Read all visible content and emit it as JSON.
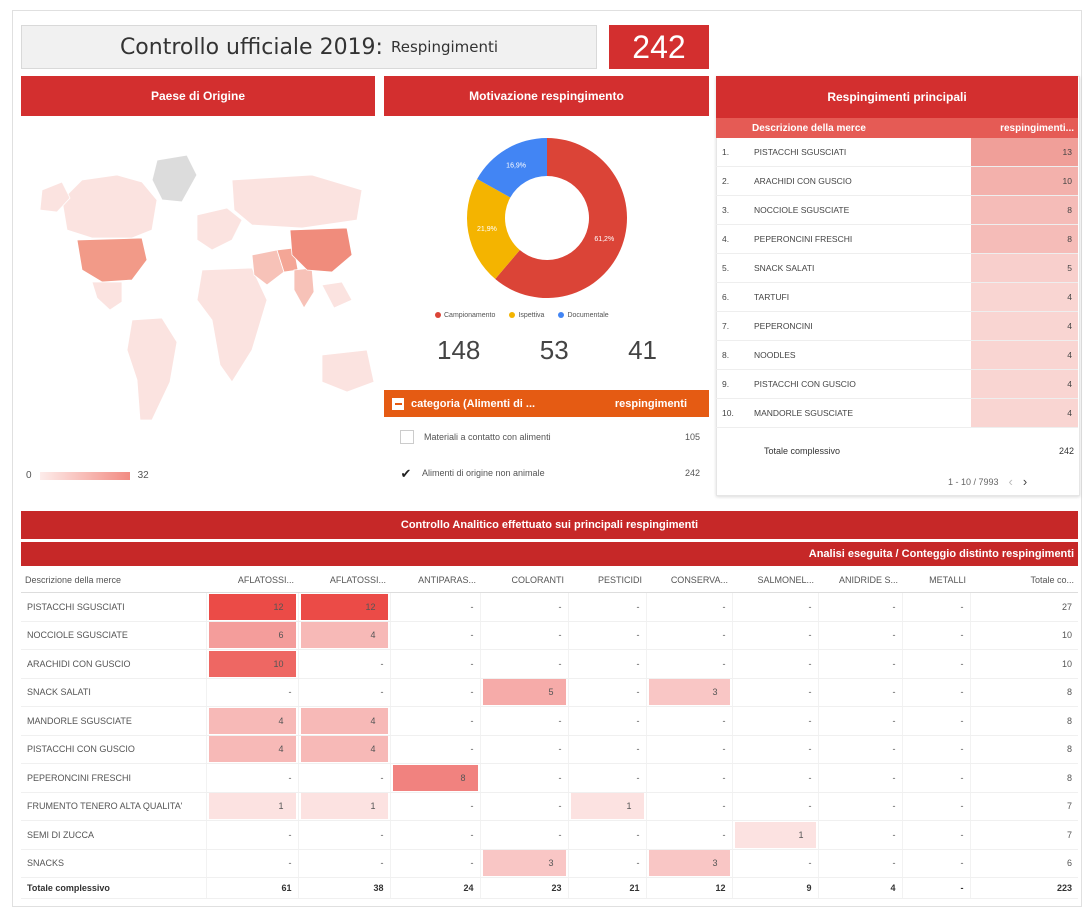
{
  "title": {
    "main": "Controllo ufficiale 2019:",
    "sub": "Respingimenti"
  },
  "total_count": "242",
  "panels": {
    "country": "Paese di Origine",
    "reason": "Motivazione respingimento",
    "top": "Respingimenti principali",
    "bottom": "Controllo Analitico effettuato sui principali respingimenti",
    "bottom_sub": "Analisi eseguita / Conteggio distinto respingimenti"
  },
  "map_legend": {
    "min": "0",
    "max": "32"
  },
  "donut": {
    "slices": [
      {
        "label": "Campionamento",
        "percent": 61.2,
        "text": "61,2%",
        "color": "#db4437"
      },
      {
        "label": "Ispettiva",
        "percent": 21.9,
        "text": "21,9%",
        "color": "#f4b400"
      },
      {
        "label": "Documentale",
        "percent": 16.9,
        "text": "16,9%",
        "color": "#4285f4"
      }
    ],
    "counts": [
      "148",
      "53",
      "41"
    ]
  },
  "category": {
    "header_label": "categoria (Alimenti di ...",
    "header_value": "respingimenti",
    "rows": [
      {
        "label": "Materiali a contatto con alimenti",
        "value": "105",
        "checked": false
      },
      {
        "label": "Alimenti di origine non animale",
        "value": "242",
        "checked": true
      }
    ]
  },
  "top_table": {
    "col_desc": "Descrizione della merce",
    "col_value": "respingimenti...",
    "rows": [
      {
        "n": "1.",
        "desc": "PISTACCHI SGUSCIATI",
        "value": "13"
      },
      {
        "n": "2.",
        "desc": "ARACHIDI CON GUSCIO",
        "value": "10"
      },
      {
        "n": "3.",
        "desc": "NOCCIOLE SGUSCIATE",
        "value": "8"
      },
      {
        "n": "4.",
        "desc": "PEPERONCINI FRESCHI",
        "value": "8"
      },
      {
        "n": "5.",
        "desc": "SNACK SALATI",
        "value": "5"
      },
      {
        "n": "6.",
        "desc": "TARTUFI",
        "value": "4"
      },
      {
        "n": "7.",
        "desc": "PEPERONCINI",
        "value": "4"
      },
      {
        "n": "8.",
        "desc": "NOODLES",
        "value": "4"
      },
      {
        "n": "9.",
        "desc": "PISTACCHI CON GUSCIO",
        "value": "4"
      },
      {
        "n": "10.",
        "desc": "MANDORLE SGUSCIATE",
        "value": "4"
      }
    ],
    "total_label": "Totale complessivo",
    "total_value": "242",
    "pager": "1 - 10 / 7993"
  },
  "analysis_table": {
    "columns": [
      "Descrizione della merce",
      "AFLATOSSI...",
      "AFLATOSSI...",
      "ANTIPARAS...",
      "COLORANTI",
      "PESTICIDI",
      "CONSERVA...",
      "SALMONEL...",
      "ANIDRIDE S...",
      "METALLI",
      "Totale co..."
    ],
    "rows": [
      {
        "desc": "PISTACCHI SGUSCIATI",
        "cells": [
          "12",
          "12",
          "-",
          "-",
          "-",
          "-",
          "-",
          "-",
          "-"
        ],
        "total": "27"
      },
      {
        "desc": "NOCCIOLE SGUSCIATE",
        "cells": [
          "6",
          "4",
          "-",
          "-",
          "-",
          "-",
          "-",
          "-",
          "-"
        ],
        "total": "10"
      },
      {
        "desc": "ARACHIDI CON GUSCIO",
        "cells": [
          "10",
          "-",
          "-",
          "-",
          "-",
          "-",
          "-",
          "-",
          "-"
        ],
        "total": "10"
      },
      {
        "desc": "SNACK SALATI",
        "cells": [
          "-",
          "-",
          "-",
          "5",
          "-",
          "3",
          "-",
          "-",
          "-"
        ],
        "total": "8"
      },
      {
        "desc": "MANDORLE SGUSCIATE",
        "cells": [
          "4",
          "4",
          "-",
          "-",
          "-",
          "-",
          "-",
          "-",
          "-"
        ],
        "total": "8"
      },
      {
        "desc": "PISTACCHI CON GUSCIO",
        "cells": [
          "4",
          "4",
          "-",
          "-",
          "-",
          "-",
          "-",
          "-",
          "-"
        ],
        "total": "8"
      },
      {
        "desc": "PEPERONCINI FRESCHI",
        "cells": [
          "-",
          "-",
          "8",
          "-",
          "-",
          "-",
          "-",
          "-",
          "-"
        ],
        "total": "8"
      },
      {
        "desc": "FRUMENTO TENERO ALTA QUALITA'",
        "cells": [
          "1",
          "1",
          "-",
          "-",
          "1",
          "-",
          "-",
          "-",
          "-"
        ],
        "total": "7"
      },
      {
        "desc": "SEMI DI ZUCCA",
        "cells": [
          "-",
          "-",
          "-",
          "-",
          "-",
          "-",
          "1",
          "-",
          "-"
        ],
        "total": "7"
      },
      {
        "desc": "SNACKS",
        "cells": [
          "-",
          "-",
          "-",
          "3",
          "-",
          "3",
          "-",
          "-",
          "-"
        ],
        "total": "6"
      }
    ],
    "totals": {
      "label": "Totale complessivo",
      "cells": [
        "61",
        "38",
        "24",
        "23",
        "21",
        "12",
        "9",
        "4",
        "-"
      ],
      "total": "223"
    }
  }
}
